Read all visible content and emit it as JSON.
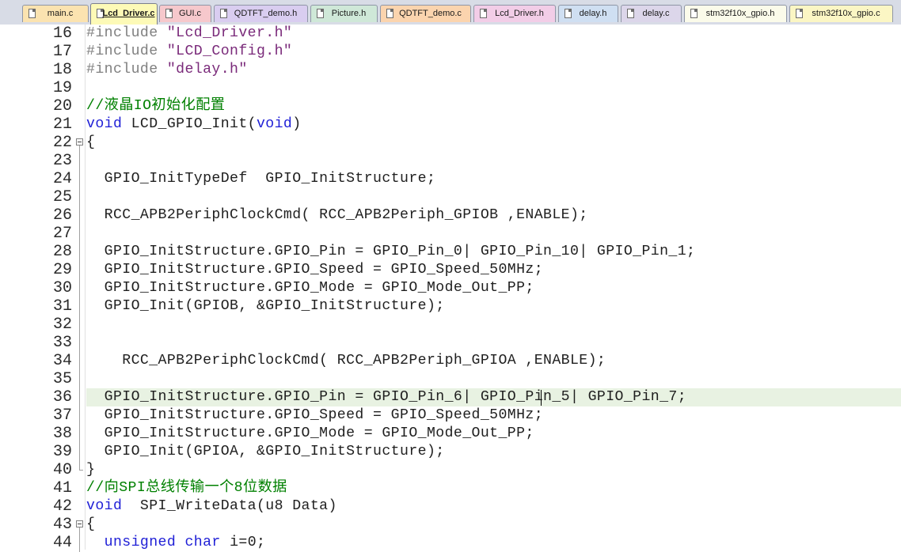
{
  "tabs": [
    {
      "label": "main.c",
      "color": "#fbe3b0",
      "active": false
    },
    {
      "label": "Lcd_Driver.c",
      "color": "#fdfab7",
      "active": true
    },
    {
      "label": "GUI.c",
      "color": "#f6c8cc",
      "active": false
    },
    {
      "label": "QDTFT_demo.h",
      "color": "#d9cdf0",
      "active": false
    },
    {
      "label": "Picture.h",
      "color": "#cfe8d8",
      "active": false
    },
    {
      "label": "QDTFT_demo.c",
      "color": "#fbd4ae",
      "active": false
    },
    {
      "label": "Lcd_Driver.h",
      "color": "#f2cde7",
      "active": false
    },
    {
      "label": "delay.h",
      "color": "#cfdff2",
      "active": false
    },
    {
      "label": "delay.c",
      "color": "#dcd6ea",
      "active": false
    },
    {
      "label": "stm32f10x_gpio.h",
      "color": "#fbfbea",
      "active": false
    },
    {
      "label": "stm32f10x_gpio.c",
      "color": "#fbf6c4",
      "active": false
    }
  ],
  "colors": {
    "preprocessor": "#808080",
    "string": "#7a2a7a",
    "comment": "#008000",
    "keyword": "#1f1fd6",
    "current_line": "#e8f2e2"
  },
  "editor": {
    "current_line": 36,
    "lines": [
      {
        "n": "16",
        "tokens": [
          {
            "t": "#include ",
            "c": "pre"
          },
          {
            "t": "\"Lcd_Driver.h\"",
            "c": "str"
          }
        ]
      },
      {
        "n": "17",
        "tokens": [
          {
            "t": "#include ",
            "c": "pre"
          },
          {
            "t": "\"LCD_Config.h\"",
            "c": "str"
          }
        ]
      },
      {
        "n": "18",
        "tokens": [
          {
            "t": "#include ",
            "c": "pre"
          },
          {
            "t": "\"delay.h\"",
            "c": "str"
          }
        ]
      },
      {
        "n": "19",
        "tokens": []
      },
      {
        "n": "20",
        "tokens": [
          {
            "t": "//液晶IO初始化配置",
            "c": "com"
          }
        ]
      },
      {
        "n": "21",
        "tokens": [
          {
            "t": "void",
            "c": "kw"
          },
          {
            "t": " LCD_GPIO_Init(",
            "c": ""
          },
          {
            "t": "void",
            "c": "kw"
          },
          {
            "t": ")",
            "c": ""
          }
        ]
      },
      {
        "n": "22",
        "fold": "open",
        "tokens": [
          {
            "t": "{",
            "c": ""
          }
        ]
      },
      {
        "n": "23",
        "fold": "line",
        "tokens": []
      },
      {
        "n": "24",
        "fold": "line",
        "tokens": [
          {
            "t": "  GPIO_InitTypeDef  GPIO_InitStructure;",
            "c": ""
          }
        ]
      },
      {
        "n": "25",
        "fold": "line",
        "tokens": []
      },
      {
        "n": "26",
        "fold": "line",
        "tokens": [
          {
            "t": "  RCC_APB2PeriphClockCmd( RCC_APB2Periph_GPIOB ,ENABLE);",
            "c": ""
          }
        ]
      },
      {
        "n": "27",
        "fold": "line",
        "tokens": []
      },
      {
        "n": "28",
        "fold": "line",
        "tokens": [
          {
            "t": "  GPIO_InitStructure.GPIO_Pin = GPIO_Pin_0| GPIO_Pin_10| GPIO_Pin_1;",
            "c": ""
          }
        ]
      },
      {
        "n": "29",
        "fold": "line",
        "tokens": [
          {
            "t": "  GPIO_InitStructure.GPIO_Speed = GPIO_Speed_50MHz;",
            "c": ""
          }
        ]
      },
      {
        "n": "30",
        "fold": "line",
        "tokens": [
          {
            "t": "  GPIO_InitStructure.GPIO_Mode = GPIO_Mode_Out_PP;",
            "c": ""
          }
        ]
      },
      {
        "n": "31",
        "fold": "line",
        "tokens": [
          {
            "t": "  GPIO_Init(GPIOB, &GPIO_InitStructure);",
            "c": ""
          }
        ]
      },
      {
        "n": "32",
        "fold": "line",
        "tokens": []
      },
      {
        "n": "33",
        "fold": "line",
        "tokens": []
      },
      {
        "n": "34",
        "fold": "line",
        "tokens": [
          {
            "t": "    RCC_APB2PeriphClockCmd( RCC_APB2Periph_GPIOA ,ENABLE);",
            "c": ""
          }
        ]
      },
      {
        "n": "35",
        "fold": "line",
        "tokens": []
      },
      {
        "n": "36",
        "fold": "line",
        "tokens": [
          {
            "t": "  GPIO_InitStructure.GPIO_Pin = GPIO_Pin_6| GPIO_Pin_5| GPIO_Pin_7;",
            "c": ""
          }
        ]
      },
      {
        "n": "37",
        "fold": "line",
        "tokens": [
          {
            "t": "  GPIO_InitStructure.GPIO_Speed = GPIO_Speed_50MHz;",
            "c": ""
          }
        ]
      },
      {
        "n": "38",
        "fold": "line",
        "tokens": [
          {
            "t": "  GPIO_InitStructure.GPIO_Mode = GPIO_Mode_Out_PP;",
            "c": ""
          }
        ]
      },
      {
        "n": "39",
        "fold": "line",
        "tokens": [
          {
            "t": "  GPIO_Init(GPIOA, &GPIO_InitStructure);",
            "c": ""
          }
        ]
      },
      {
        "n": "40",
        "fold": "end",
        "tokens": [
          {
            "t": "}",
            "c": ""
          }
        ]
      },
      {
        "n": "41",
        "tokens": [
          {
            "t": "//向SPI总线传输一个8位数据",
            "c": "com"
          }
        ]
      },
      {
        "n": "42",
        "tokens": [
          {
            "t": "void",
            "c": "kw"
          },
          {
            "t": "  SPI_WriteData(u8 Data)",
            "c": ""
          }
        ]
      },
      {
        "n": "43",
        "fold": "open",
        "tokens": [
          {
            "t": "{",
            "c": ""
          }
        ]
      },
      {
        "n": "44",
        "fold": "line",
        "tokens": [
          {
            "t": "  ",
            "c": ""
          },
          {
            "t": "unsigned",
            "c": "kw"
          },
          {
            "t": " ",
            "c": ""
          },
          {
            "t": "char",
            "c": "kw"
          },
          {
            "t": " i=",
            "c": ""
          },
          {
            "t": "0",
            "c": "num"
          },
          {
            "t": ";",
            "c": ""
          }
        ]
      }
    ]
  }
}
